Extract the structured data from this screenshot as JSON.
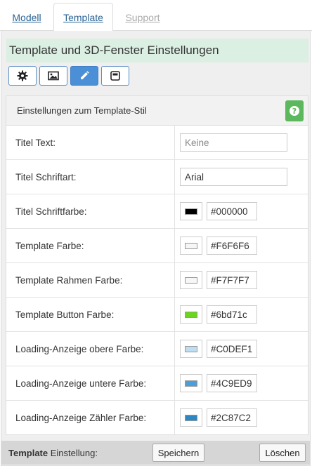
{
  "tabs": [
    {
      "label": "Modell"
    },
    {
      "label": "Template"
    },
    {
      "label": "Support"
    }
  ],
  "header": {
    "title": "Template und 3D-Fenster Einstellungen"
  },
  "toolbar": {
    "icons": [
      "gear-icon",
      "image-icon",
      "pencil-icon",
      "window-icon"
    ],
    "active_index": 2
  },
  "section": {
    "title": "Einstellungen zum Template-Stil",
    "help_icon": "question-icon"
  },
  "fields": {
    "title_text": {
      "label": "Titel Text:",
      "placeholder": "Keine",
      "value": ""
    },
    "title_font": {
      "label": "Titel Schriftart:",
      "value": "Arial"
    }
  },
  "colors": [
    {
      "label": "Titel Schriftfarbe:",
      "hex": "#000000"
    },
    {
      "label": "Template Farbe:",
      "hex": "#F6F6F6"
    },
    {
      "label": "Template Rahmen Farbe:",
      "hex": "#F7F7F7"
    },
    {
      "label": "Template Button Farbe:",
      "hex": "#6bd71c"
    },
    {
      "label": "Loading-Anzeige obere Farbe:",
      "hex": "#C0DEF1"
    },
    {
      "label": "Loading-Anzeige untere Farbe:",
      "hex": "#4C9ED9"
    },
    {
      "label": "Loading-Anzeige Zähler Farbe:",
      "hex": "#2C87C2"
    }
  ],
  "footer": {
    "label_bold": "Template",
    "label_rest": " Einstellung:",
    "save_label": "Speichern",
    "delete_label": "Löschen"
  }
}
